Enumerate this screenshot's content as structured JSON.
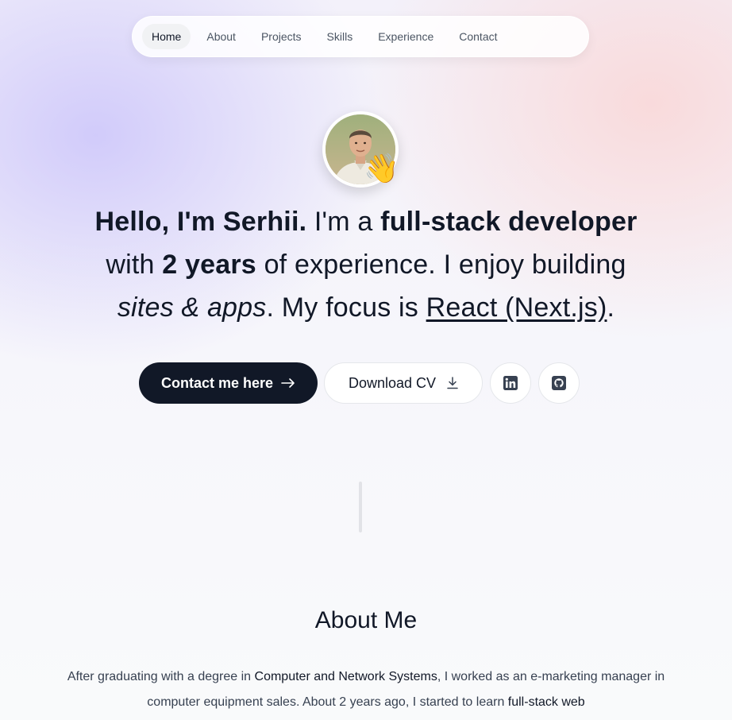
{
  "nav": {
    "items": [
      {
        "label": "Home",
        "active": true
      },
      {
        "label": "About"
      },
      {
        "label": "Projects"
      },
      {
        "label": "Skills"
      },
      {
        "label": "Experience"
      },
      {
        "label": "Contact"
      }
    ]
  },
  "hero": {
    "avatar_icon": "profile-photo",
    "wave_emoji": "👋",
    "headline": {
      "p1": "Hello, I'm Serhii.",
      "p2": " I'm a ",
      "p3": "full-stack developer",
      "p4": " with ",
      "p5": "2 years",
      "p6": " of experience. I enjoy building ",
      "p7": "sites & apps",
      "p8": ". My focus is ",
      "p9": "React (Next.js)",
      "p10": "."
    },
    "buttons": {
      "contact_label": "Contact me here",
      "contact_icon": "arrow-right-icon",
      "cv_label": "Download CV",
      "cv_icon": "download-icon",
      "linkedin_icon": "linkedin-icon",
      "github_icon": "github-icon"
    }
  },
  "about": {
    "title": "About Me",
    "t1": "After graduating with a degree in ",
    "t2": "Computer and Network Systems",
    "t3": ", I worked as an e-marketing manager in computer equipment sales. About 2 years ago, I started to learn ",
    "t4": "full-stack web"
  },
  "colors": {
    "dark": "#111827",
    "accent_lavender": "#cbc4fa",
    "accent_pink": "#fad6d6"
  }
}
